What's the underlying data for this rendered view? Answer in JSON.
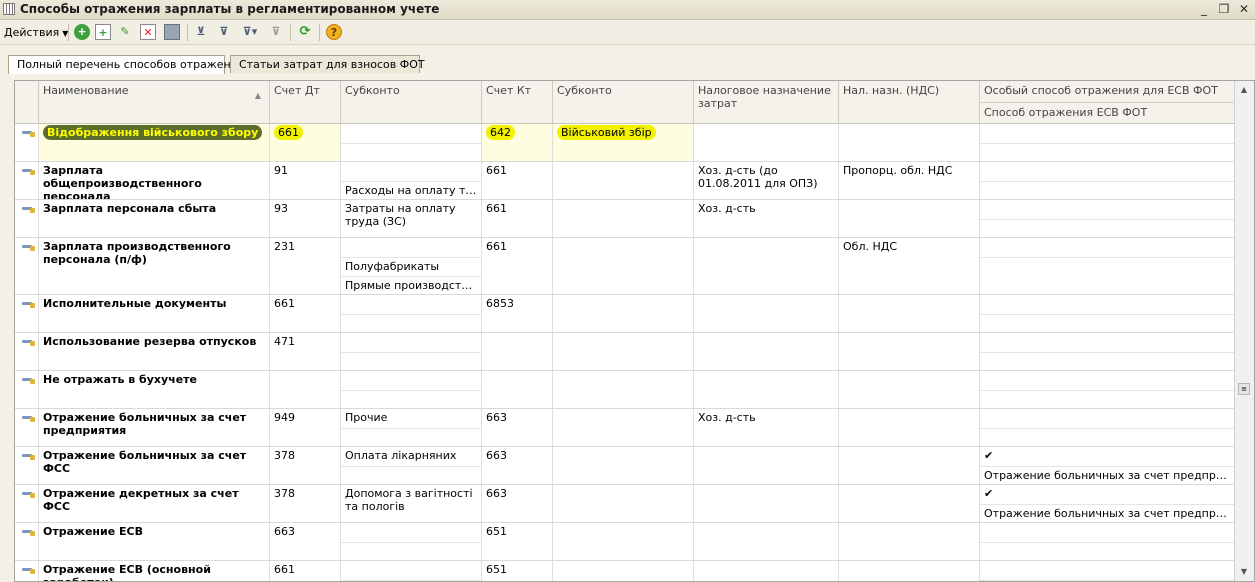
{
  "window": {
    "title": "Способы отражения зарплаты в регламентированном учете"
  },
  "toolbar": {
    "actions_label": "Действия",
    "icons": [
      "add-icon",
      "add-copy-icon",
      "edit-icon",
      "delete-icon",
      "save-icon",
      "filter-set-icon",
      "filter-icon",
      "filter-dropdown-icon",
      "filter-clear-icon",
      "refresh-icon",
      "help-icon"
    ]
  },
  "tabs": [
    {
      "label": "Полный перечень способов отражения",
      "active": true
    },
    {
      "label": "Статьи затрат для взносов ФОТ",
      "active": false
    }
  ],
  "columns": {
    "name": "Наименование",
    "debit": "Счет Дт",
    "subconto1": "Субконто",
    "credit": "Счет Кт",
    "subconto2": "Субконто",
    "tax_purpose": "Налоговое назначение затрат",
    "vat_purpose": "Нал. назн. (НДС)",
    "esv_special": "Особый способ отражения для ЕСВ ФОТ",
    "esv_method": "Способ отражения ЕСВ ФОТ"
  },
  "rows": [
    {
      "name": "Відображення військового збору",
      "debit": "661",
      "sub1_a": "",
      "sub1_b": "",
      "sub1_c": "",
      "credit": "642",
      "sub2": "Військовий збір",
      "tax": "",
      "vat": "",
      "esv_check": "",
      "esv_method": ""
    },
    {
      "name": "Зарплата общепроизводственного персонала",
      "debit": "91",
      "sub1_a": "",
      "sub1_b": "Расходы на оплату труда...",
      "sub1_c": "",
      "credit": "661",
      "sub2": "",
      "tax": "Хоз. д-сть (до 01.08.2011 для ОПЗ)",
      "vat": "Пропорц. обл. НДС",
      "esv_check": "",
      "esv_method": ""
    },
    {
      "name": "Зарплата персонала сбыта",
      "debit": "93",
      "sub1_a": "Затраты на оплату труда (ЗС)",
      "sub1_b": "",
      "sub1_c": "",
      "credit": "661",
      "sub2": "",
      "tax": "Хоз. д-сть",
      "vat": "",
      "esv_check": "",
      "esv_method": ""
    },
    {
      "name": "Зарплата производственного персонала (п/ф)",
      "debit": "231",
      "sub1_a": "",
      "sub1_b": "Полуфабрикаты",
      "sub1_c": "Прямые производствен...",
      "credit": "661",
      "sub2": "",
      "tax": "",
      "vat": "Обл. НДС",
      "esv_check": "",
      "esv_method": ""
    },
    {
      "name": "Исполнительные документы",
      "debit": "661",
      "sub1_a": "",
      "sub1_b": "",
      "sub1_c": "",
      "credit": "6853",
      "sub2": "",
      "tax": "",
      "vat": "",
      "esv_check": "",
      "esv_method": ""
    },
    {
      "name": "Использование резерва отпусков",
      "debit": "471",
      "sub1_a": "",
      "sub1_b": "",
      "sub1_c": "",
      "credit": "",
      "sub2": "",
      "tax": "",
      "vat": "",
      "esv_check": "",
      "esv_method": ""
    },
    {
      "name": "Не отражать в бухучете",
      "debit": "",
      "sub1_a": "",
      "sub1_b": "",
      "sub1_c": "",
      "credit": "",
      "sub2": "",
      "tax": "",
      "vat": "",
      "esv_check": "",
      "esv_method": ""
    },
    {
      "name": "Отражение больничных за счет предприятия",
      "debit": "949",
      "sub1_a": "Прочие",
      "sub1_b": "",
      "sub1_c": "",
      "credit": "663",
      "sub2": "",
      "tax": "Хоз. д-сть",
      "vat": "",
      "esv_check": "",
      "esv_method": ""
    },
    {
      "name": "Отражение больничных за счет ФСС",
      "debit": "378",
      "sub1_a": "Оплата лікарняних",
      "sub1_b": "",
      "sub1_c": "",
      "credit": "663",
      "sub2": "",
      "tax": "",
      "vat": "",
      "esv_check": "✔",
      "esv_method": "Отражение больничных за счет предприятия"
    },
    {
      "name": "Отражение декретных за счет ФСС",
      "debit": "378",
      "sub1_a": "Допомога з вагітності та пологів",
      "sub1_b": "",
      "sub1_c": "",
      "credit": "663",
      "sub2": "",
      "tax": "",
      "vat": "",
      "esv_check": "✔",
      "esv_method": "Отражение больничных за счет предприятия"
    },
    {
      "name": "Отражение ЕСВ",
      "debit": "663",
      "sub1_a": "",
      "sub1_b": "",
      "sub1_c": "",
      "credit": "651",
      "sub2": "",
      "tax": "",
      "vat": "",
      "esv_check": "",
      "esv_method": ""
    },
    {
      "name": "Отражение ЕСВ (основной заработок)",
      "debit": "661",
      "sub1_a": "",
      "sub1_b": "",
      "sub1_c": "",
      "credit": "651",
      "sub2": "",
      "tax": "",
      "vat": "",
      "esv_check": "",
      "esv_method": ""
    }
  ]
}
